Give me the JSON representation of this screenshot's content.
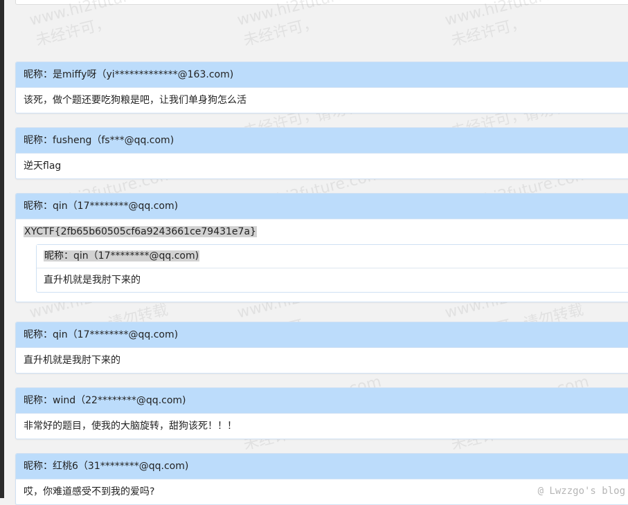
{
  "nickname_label": "昵称：",
  "watermark": {
    "site": "www.hi2future.com",
    "notice_a": "未经许可，",
    "notice_b": "请勿转载"
  },
  "corner_mark": "@ Lwzzgo's blog",
  "comments": [
    {
      "name": "是miffy呀",
      "email": "（yi*************@163.com)",
      "text": "该死，做个题还要吃狗粮是吧，让我们单身狗怎么活"
    },
    {
      "name": "fusheng",
      "email": "（fs***@qq.com)",
      "text": "逆天flag"
    },
    {
      "name": "qin",
      "email": "（17********@qq.com)",
      "text": "XYCTF{2fb65b60505cf6a9243661ce79431e7a}",
      "reply": {
        "name": "qin",
        "email": "（17********@qq.com)",
        "text": "直升机就是我肘下来的"
      }
    },
    {
      "name": "qin",
      "email": "（17********@qq.com)",
      "text": "直升机就是我肘下来的"
    },
    {
      "name": "wind",
      "email": "（22********@qq.com)",
      "text": "非常好的题目，使我的大脑旋转，甜狗该死！！！"
    },
    {
      "name": "红桃6",
      "email": "（31********@qq.com)",
      "text": "哎，你难道感受不到我的爱吗?"
    }
  ]
}
